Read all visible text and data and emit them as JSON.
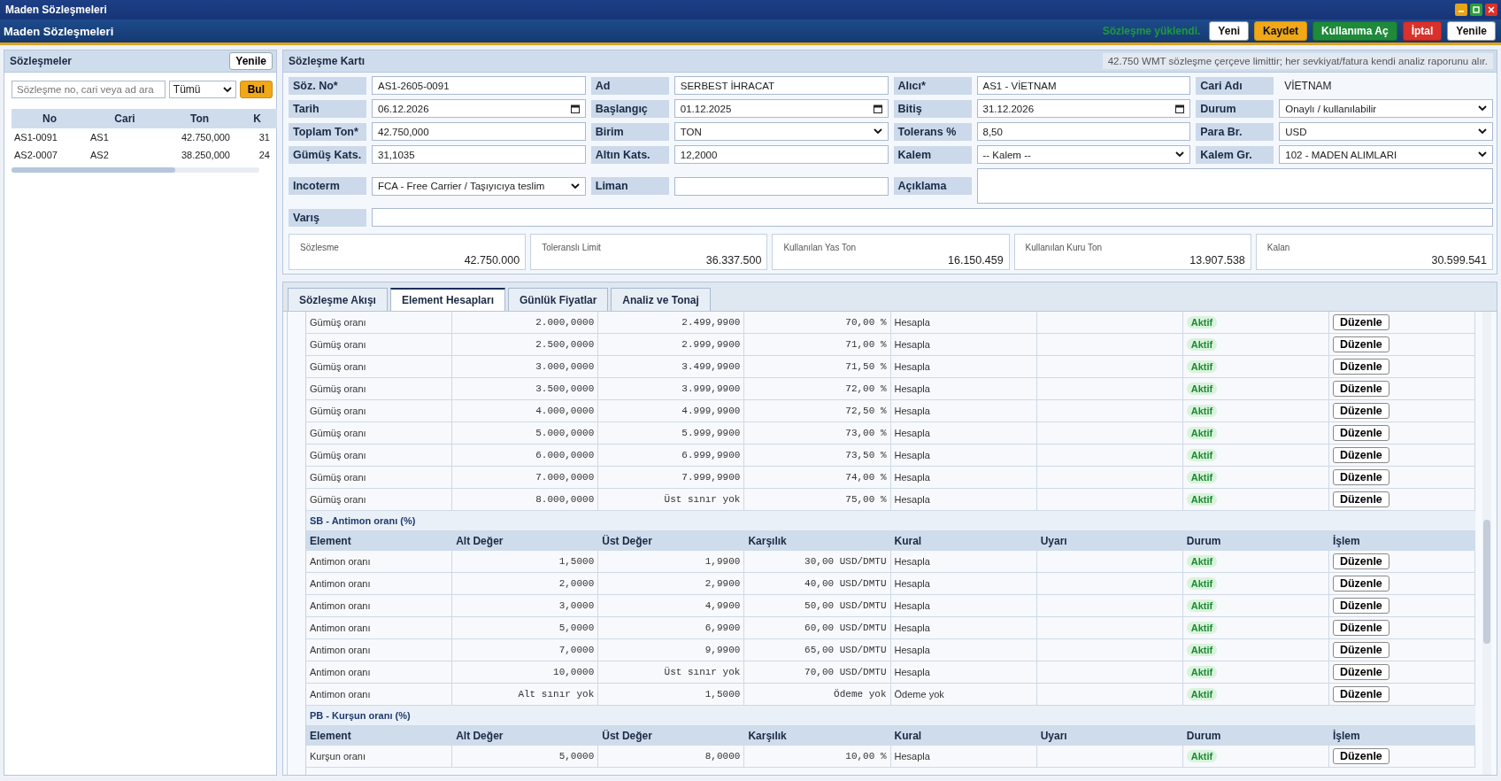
{
  "window": {
    "title": "Maden Sözleşmeleri"
  },
  "header": {
    "title": "Maden Sözleşmeleri",
    "status": "Sözleşme yüklendi.",
    "buttons": [
      {
        "label": "Yeni",
        "kind": "default"
      },
      {
        "label": "Kaydet",
        "kind": "warning"
      },
      {
        "label": "Kullanıma Aç",
        "kind": "success"
      },
      {
        "label": "İptal",
        "kind": "danger"
      },
      {
        "label": "Yenile",
        "kind": "default"
      }
    ]
  },
  "sidebar": {
    "title": "Sözleşmeler",
    "refresh": "Yenile",
    "search": {
      "placeholder": "Sözleşme no, cari veya ad ara"
    },
    "filter": "Tümü",
    "find": "Bul",
    "columns": [
      "No",
      "Cari",
      "Ton",
      "K"
    ],
    "rows": [
      [
        "AS1-0091",
        "AS1",
        "42.750,000",
        "31"
      ],
      [
        "AS2-0007",
        "AS2",
        "38.250,000",
        "24"
      ]
    ]
  },
  "card": {
    "title": "Sözleşme Kartı",
    "note": "42.750 WMT sözleşme çerçeve limittir; her sevkiyat/fatura kendi analiz raporunu alır.",
    "rows": [
      [
        {
          "label": "Söz. No*",
          "kind": "text",
          "value": "AS1-2605-0091"
        },
        {
          "label": "Ad",
          "kind": "text",
          "value": "SERBEST İHRACAT"
        },
        {
          "label": "Alıcı*",
          "kind": "text",
          "value": "AS1 - VİETNAM"
        },
        {
          "label": "Cari Adı",
          "kind": "static",
          "value": "VİETNAM"
        }
      ],
      [
        {
          "label": "Tarih",
          "kind": "date",
          "value": "06.12.2026"
        },
        {
          "label": "Başlangıç",
          "kind": "date",
          "value": "01.12.2025"
        },
        {
          "label": "Bitiş",
          "kind": "date",
          "value": "31.12.2026"
        },
        {
          "label": "Durum",
          "kind": "select",
          "value": "Onaylı / kullanılabilir"
        }
      ],
      [
        {
          "label": "Toplam Ton*",
          "kind": "text",
          "value": "42.750,000"
        },
        {
          "label": "Birim",
          "kind": "select",
          "value": "TON"
        },
        {
          "label": "Tolerans %",
          "kind": "text",
          "value": "8,50"
        },
        {
          "label": "Para Br.",
          "kind": "select",
          "value": "USD"
        }
      ],
      [
        {
          "label": "Gümüş Kats.",
          "kind": "text",
          "value": "31,1035"
        },
        {
          "label": "Altın Kats.",
          "kind": "text",
          "value": "12,2000"
        },
        {
          "label": "Kalem",
          "kind": "select",
          "value": "-- Kalem --"
        },
        {
          "label": "Kalem Gr.",
          "kind": "select",
          "value": "102 - MADEN ALIMLARI"
        }
      ],
      [
        {
          "label": "Incoterm",
          "kind": "select",
          "value": "FCA - Free Carrier / Taşıyıcıya teslim"
        },
        {
          "label": "Liman",
          "kind": "text"
        },
        {
          "label": "Açıklama",
          "kind": "textarea"
        }
      ],
      [
        {
          "label": "Varış",
          "kind": "text"
        }
      ]
    ],
    "stats": [
      {
        "label": "Sözlesme",
        "value": "42.750.000"
      },
      {
        "label": "Toleranslı Limit",
        "value": "36.337.500"
      },
      {
        "label": "Kullanılan Yas Ton",
        "value": "16.150.459"
      },
      {
        "label": "Kullanılan Kuru Ton",
        "value": "13.907.538"
      },
      {
        "label": "Kalan",
        "value": "30.599.541"
      }
    ]
  },
  "tabs": [
    {
      "label": "Sözleşme Akışı",
      "selected": false
    },
    {
      "label": "Element Hesapları",
      "selected": true
    },
    {
      "label": "Günlük Fiyatlar",
      "selected": false
    },
    {
      "label": "Analiz ve Tonaj",
      "selected": false
    }
  ],
  "element_table": {
    "sections": [
      {
        "rows": [
          [
            "Gümüş oranı",
            "2.000,0000",
            "2.499,9900",
            "70,00 %",
            "Hesapla",
            "",
            "Aktif",
            "Düzenle"
          ],
          [
            "Gümüş oranı",
            "2.500,0000",
            "2.999,9900",
            "71,00 %",
            "Hesapla",
            "",
            "Aktif",
            "Düzenle"
          ],
          [
            "Gümüş oranı",
            "3.000,0000",
            "3.499,9900",
            "71,50 %",
            "Hesapla",
            "",
            "Aktif",
            "Düzenle"
          ],
          [
            "Gümüş oranı",
            "3.500,0000",
            "3.999,9900",
            "72,00 %",
            "Hesapla",
            "",
            "Aktif",
            "Düzenle"
          ],
          [
            "Gümüş oranı",
            "4.000,0000",
            "4.999,9900",
            "72,50 %",
            "Hesapla",
            "",
            "Aktif",
            "Düzenle"
          ],
          [
            "Gümüş oranı",
            "5.000,0000",
            "5.999,9900",
            "73,00 %",
            "Hesapla",
            "",
            "Aktif",
            "Düzenle"
          ],
          [
            "Gümüş oranı",
            "6.000,0000",
            "6.999,9900",
            "73,50 %",
            "Hesapla",
            "",
            "Aktif",
            "Düzenle"
          ],
          [
            "Gümüş oranı",
            "7.000,0000",
            "7.999,9900",
            "74,00 %",
            "Hesapla",
            "",
            "Aktif",
            "Düzenle"
          ],
          [
            "Gümüş oranı",
            "8.000,0000",
            "Üst sınır yok",
            "75,00 %",
            "Hesapla",
            "",
            "Aktif",
            "Düzenle"
          ]
        ]
      },
      {
        "title": "SB - Antimon oranı (%)",
        "columns": [
          "Element",
          "Alt Değer",
          "Üst Değer",
          "Karşılık",
          "Kural",
          "Uyarı",
          "Durum",
          "İşlem"
        ],
        "rows": [
          [
            "Antimon oranı",
            "1,5000",
            "1,9900",
            "30,00 USD/DMTU",
            "Hesapla",
            "",
            "Aktif",
            "Düzenle"
          ],
          [
            "Antimon oranı",
            "2,0000",
            "2,9900",
            "40,00 USD/DMTU",
            "Hesapla",
            "",
            "Aktif",
            "Düzenle"
          ],
          [
            "Antimon oranı",
            "3,0000",
            "4,9900",
            "50,00 USD/DMTU",
            "Hesapla",
            "",
            "Aktif",
            "Düzenle"
          ],
          [
            "Antimon oranı",
            "5,0000",
            "6,9900",
            "60,00 USD/DMTU",
            "Hesapla",
            "",
            "Aktif",
            "Düzenle"
          ],
          [
            "Antimon oranı",
            "7,0000",
            "9,9900",
            "65,00 USD/DMTU",
            "Hesapla",
            "",
            "Aktif",
            "Düzenle"
          ],
          [
            "Antimon oranı",
            "10,0000",
            "Üst sınır yok",
            "70,00 USD/DMTU",
            "Hesapla",
            "",
            "Aktif",
            "Düzenle"
          ],
          [
            "Antimon oranı",
            "Alt sınır yok",
            "1,5000",
            "Ödeme yok",
            "Ödeme yok",
            "",
            "Aktif",
            "Düzenle"
          ]
        ]
      },
      {
        "title": "PB - Kurşun oranı (%)",
        "columns": [
          "Element",
          "Alt Değer",
          "Üst Değer",
          "Karşılık",
          "Kural",
          "Uyarı",
          "Durum",
          "İşlem"
        ],
        "rows": [
          [
            "Kurşun oranı",
            "5,0000",
            "8,0000",
            "10,00 %",
            "Hesapla",
            "",
            "Aktif",
            "Düzenle"
          ]
        ]
      }
    ]
  }
}
